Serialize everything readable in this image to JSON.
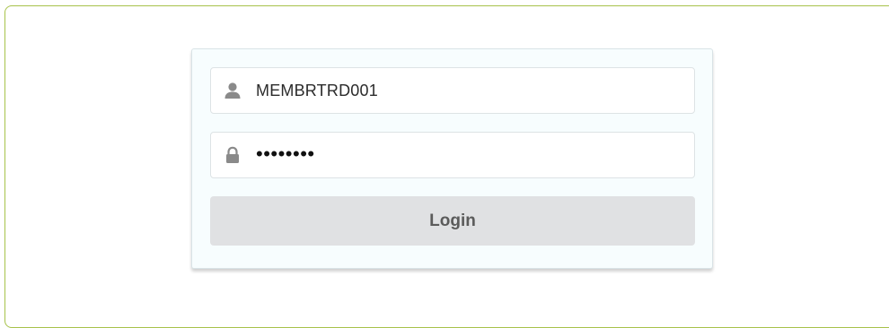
{
  "login_form": {
    "username": {
      "icon": "user-icon",
      "value": "MEMBRTRD001"
    },
    "password": {
      "icon": "lock-icon",
      "masked_value": "••••••••"
    },
    "login_button": {
      "label": "Login"
    }
  },
  "colors": {
    "frame_border": "#a7c24a",
    "card_background": "#f7fdfe",
    "button_background": "#e0e1e3",
    "button_text": "#5b5b5b",
    "icon_gray": "#8a8a8a"
  }
}
